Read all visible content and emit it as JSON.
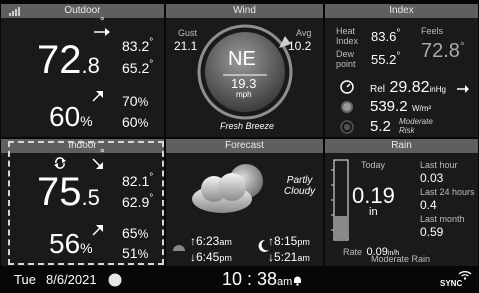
{
  "headers": {
    "outdoor": "Outdoor",
    "wind": "Wind",
    "index": "Index",
    "indoor": "Indoor",
    "forecast": "Forecast",
    "rain": "Rain"
  },
  "signal_icon": "signal-bars-icon",
  "outdoor": {
    "temp_int": "72",
    "temp_dec": ".8",
    "temp_max": "83.2",
    "temp_min": "65.2",
    "deg_symbol": "°",
    "temp_trend": "right-arrow",
    "humidity": "60",
    "humidity_unit": "%",
    "hum_max": "70",
    "hum_min": "60",
    "hum_trend": "up-right-arrow"
  },
  "wind": {
    "gust_label": "Gust",
    "gust_value": "21.1",
    "avg_label": "Avg",
    "avg_value": "10.2",
    "direction": "NE",
    "speed": "19.3",
    "unit": "mph",
    "description": "Fresh Breeze"
  },
  "index": {
    "heat_label_1": "Heat",
    "heat_label_2": "Index",
    "heat_value": "83.6",
    "feels_label": "Feels",
    "feels_value": "72.8",
    "dew_label_1": "Dew",
    "dew_label_2": "point",
    "dew_value": "55.2",
    "pressure_prefix": "Rel",
    "pressure_value": "29.82",
    "pressure_unit": "inHg",
    "pressure_trend": "right-arrow",
    "solar_value": "539.2",
    "solar_unit": "W/m²",
    "uv_value": "5.2",
    "uv_label_1": "Moderate",
    "uv_label_2": "Risk"
  },
  "indoor": {
    "temp_int": "75",
    "temp_dec": ".5",
    "temp_max": "82.1",
    "temp_min": "62.9",
    "humidity": "56",
    "humidity_unit": "%",
    "hum_max": "65",
    "hum_min": "51"
  },
  "forecast": {
    "condition_line1": "Partly",
    "condition_line2": "Cloudy",
    "sunrise": "6:23",
    "sunrise_unit": "am",
    "sunset": "6:45",
    "sunset_unit": "pm",
    "moonrise": "8:15",
    "moonrise_unit": "pm",
    "moonset": "5:21",
    "moonset_unit": "am"
  },
  "rain": {
    "today_label": "Today",
    "today_value": "0.19",
    "today_unit": "in",
    "last_hour_label": "Last hour",
    "last_hour_value": "0.03",
    "last_24_label": "Last 24 hours",
    "last_24_value": "0.4",
    "last_month_label": "Last month",
    "last_month_value": "0.59",
    "rate_label": "Rate",
    "rate_value": "0.09",
    "rate_unit": "in/h",
    "rate_description": "Moderate Rain",
    "gauge_fill_fraction": 0.3
  },
  "status": {
    "day": "Tue",
    "date": "8/6/2021",
    "time": "10 : 38",
    "ampm": "am",
    "sync_label": "SYNC"
  },
  "colors": {
    "header_bg": "#5f5f5f",
    "panel_bg": "#1a1a1a",
    "text": "#ffffff",
    "label": "#bdbdbd"
  }
}
